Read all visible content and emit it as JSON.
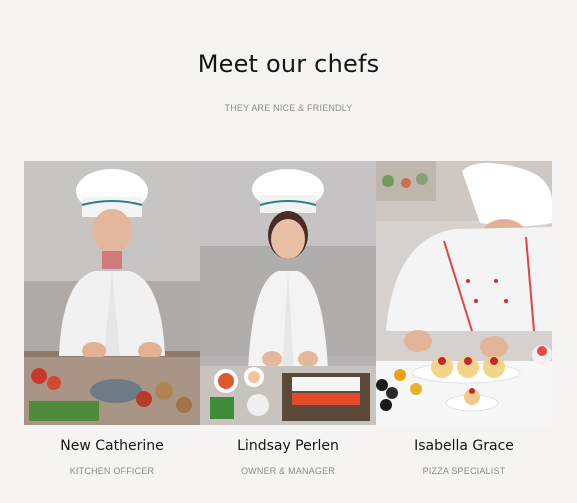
{
  "section": {
    "title": "Meet our chefs",
    "subtitle": "THEY ARE NICE & FRIENDLY"
  },
  "chefs": [
    {
      "name": "New Catherine",
      "role": "KITCHEN OFFICER"
    },
    {
      "name": "Lindsay Perlen",
      "role": "OWNER & MANAGER"
    },
    {
      "name": "Isabella Grace",
      "role": "PIZZA SPECIALIST"
    }
  ],
  "colors": {
    "background": "#f6f4f3",
    "title": "#141414",
    "muted": "#8c8a88"
  }
}
